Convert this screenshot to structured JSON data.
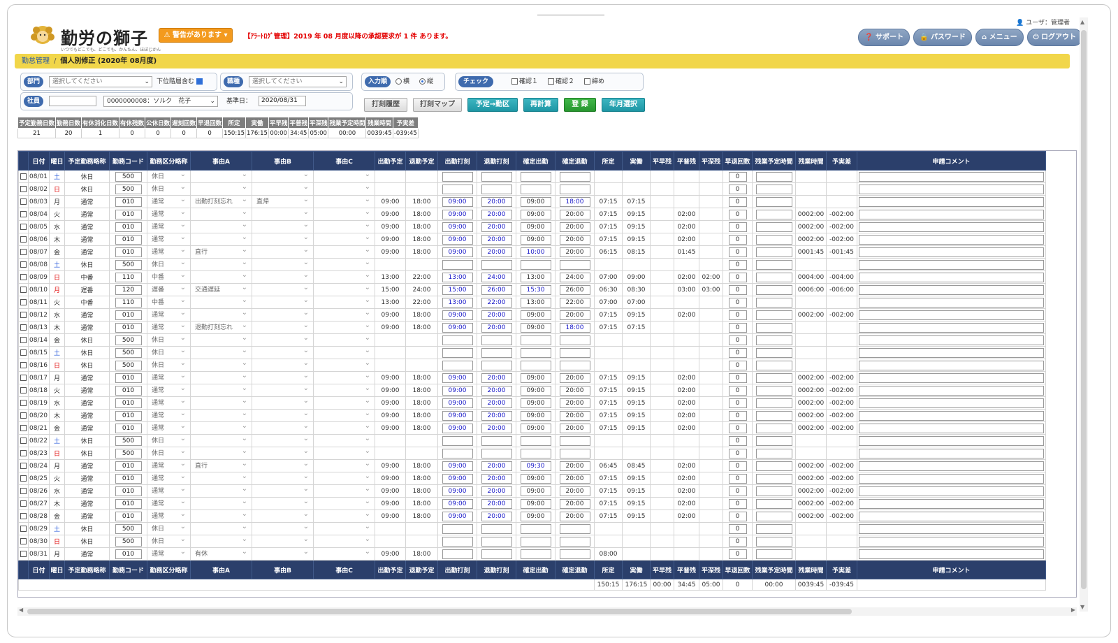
{
  "header": {
    "logo_text": "勤労の獅子",
    "logo_sub": "いつでもどこでも、どこでも、かんたん、ほぼじかん",
    "alert_button": "⚠ 警告があります ▾",
    "alert_message": "【ｱﾗｰﾄﾛｸﾞ管理】2019 年 08 月度以降の承認要求が 1 件 あります。",
    "user_label": "ユーザ：管理者",
    "nav": [
      "サポート",
      "パスワード",
      "メニュー",
      "ログアウト"
    ]
  },
  "breadcrumb": {
    "parent": "勤怠管理",
    "current": "個人別修正 (2020年 08月度)"
  },
  "filters": {
    "dept_label": "部門",
    "dept_value": "選択してください",
    "sub_dept": "下位階層含む",
    "job_label": "職種",
    "job_value": "選択してください",
    "input_label": "入力順",
    "radio_h": "横",
    "radio_v": "縦",
    "check_label": "チェック",
    "confirm1": "確認１",
    "confirm2": "確認２",
    "closing": "締め",
    "emp_label": "社員",
    "emp_code": "",
    "emp_value": "0000000008：ソルク　花子",
    "base_date_label": "基準日：",
    "base_date": "2020/08/31"
  },
  "actions": [
    "打刻履歴",
    "打刻マップ",
    "予定→勤区",
    "再計算",
    "登 録",
    "年月選択"
  ],
  "summary": {
    "headers": [
      "予定勤務日数",
      "勤務日数",
      "有休消化日数",
      "有休残数",
      "公休日数",
      "遅刻回数",
      "早退回数",
      "所定",
      "実働",
      "平早残",
      "平普残",
      "平深残",
      "残業予定時間",
      "残業時間",
      "予実差"
    ],
    "values": [
      "21",
      "20",
      "1",
      "0",
      "0",
      "0",
      "0",
      "150:15",
      "176:15",
      "00:00",
      "34:45",
      "05:00",
      "00:00",
      "0039:45",
      "-039:45"
    ]
  },
  "grid": {
    "headers": [
      "",
      "日付",
      "曜日",
      "予定勤務略称",
      "勤務コード",
      "勤務区分略称",
      "事由A",
      "事由B",
      "事由C",
      "出勤予定",
      "退勤予定",
      "出勤打刻",
      "退勤打刻",
      "確定出勤",
      "確定退勤",
      "所定",
      "実働",
      "平早残",
      "平普残",
      "平深残",
      "早退回数",
      "残業予定時間",
      "残業時間",
      "予実差",
      "申請コメント"
    ],
    "rows": [
      {
        "date": "08/01",
        "dow": "土",
        "plan": "休日",
        "code": "500",
        "kubun": "休日",
        "a": "",
        "b": "",
        "st_p": "",
        "en_p": "",
        "st_s": "",
        "en_s": "",
        "st_c": "",
        "en_c": "",
        "shotei": "",
        "jitsu": "",
        "hs": "",
        "hf": "",
        "hsh": "",
        "early": "0",
        "ot": "",
        "diff": "",
        "d": "sat"
      },
      {
        "date": "08/02",
        "dow": "日",
        "plan": "休日",
        "code": "500",
        "kubun": "休日",
        "a": "",
        "b": "",
        "st_p": "",
        "en_p": "",
        "st_s": "",
        "en_s": "",
        "st_c": "",
        "en_c": "",
        "shotei": "",
        "jitsu": "",
        "hs": "",
        "hf": "",
        "hsh": "",
        "early": "0",
        "ot": "",
        "diff": "",
        "d": "sun"
      },
      {
        "date": "08/03",
        "dow": "月",
        "plan": "通常",
        "code": "010",
        "kubun": "通常",
        "a": "出勤打刻忘れ",
        "b": "直帰",
        "st_p": "09:00",
        "en_p": "18:00",
        "st_s": "09:00",
        "en_s": "20:00",
        "st_c": "09:00",
        "en_c": "18:00",
        "shotei": "07:15",
        "jitsu": "07:15",
        "hs": "",
        "hf": "",
        "hsh": "",
        "early": "0",
        "ot": "",
        "diff": "",
        "d": ""
      },
      {
        "date": "08/04",
        "dow": "火",
        "plan": "通常",
        "code": "010",
        "kubun": "通常",
        "a": "",
        "b": "",
        "st_p": "09:00",
        "en_p": "18:00",
        "st_s": "09:00",
        "en_s": "20:00",
        "st_c": "09:00",
        "en_c": "20:00",
        "shotei": "07:15",
        "jitsu": "09:15",
        "hs": "",
        "hf": "02:00",
        "hsh": "",
        "early": "0",
        "ot": "0002:00",
        "diff": "-002:00",
        "d": ""
      },
      {
        "date": "08/05",
        "dow": "水",
        "plan": "通常",
        "code": "010",
        "kubun": "通常",
        "a": "",
        "b": "",
        "st_p": "09:00",
        "en_p": "18:00",
        "st_s": "09:00",
        "en_s": "20:00",
        "st_c": "09:00",
        "en_c": "20:00",
        "shotei": "07:15",
        "jitsu": "09:15",
        "hs": "",
        "hf": "02:00",
        "hsh": "",
        "early": "0",
        "ot": "0002:00",
        "diff": "-002:00",
        "d": ""
      },
      {
        "date": "08/06",
        "dow": "木",
        "plan": "通常",
        "code": "010",
        "kubun": "通常",
        "a": "",
        "b": "",
        "st_p": "09:00",
        "en_p": "18:00",
        "st_s": "09:00",
        "en_s": "20:00",
        "st_c": "09:00",
        "en_c": "20:00",
        "shotei": "07:15",
        "jitsu": "09:15",
        "hs": "",
        "hf": "02:00",
        "hsh": "",
        "early": "0",
        "ot": "0002:00",
        "diff": "-002:00",
        "d": ""
      },
      {
        "date": "08/07",
        "dow": "金",
        "plan": "通常",
        "code": "010",
        "kubun": "通常",
        "a": "直行",
        "b": "",
        "st_p": "09:00",
        "en_p": "18:00",
        "st_s": "09:00",
        "en_s": "20:00",
        "st_c": "10:00",
        "en_c": "20:00",
        "shotei": "06:15",
        "jitsu": "08:15",
        "hs": "",
        "hf": "01:45",
        "hsh": "",
        "early": "0",
        "ot": "0001:45",
        "diff": "-001:45",
        "d": ""
      },
      {
        "date": "08/08",
        "dow": "土",
        "plan": "休日",
        "code": "500",
        "kubun": "休日",
        "a": "",
        "b": "",
        "st_p": "",
        "en_p": "",
        "st_s": "",
        "en_s": "",
        "st_c": "",
        "en_c": "",
        "shotei": "",
        "jitsu": "",
        "hs": "",
        "hf": "",
        "hsh": "",
        "early": "0",
        "ot": "",
        "diff": "",
        "d": "sat"
      },
      {
        "date": "08/09",
        "dow": "日",
        "plan": "中番",
        "code": "110",
        "kubun": "中番",
        "a": "",
        "b": "",
        "st_p": "13:00",
        "en_p": "22:00",
        "st_s": "13:00",
        "en_s": "24:00",
        "st_c": "13:00",
        "en_c": "24:00",
        "shotei": "07:00",
        "jitsu": "09:00",
        "hs": "",
        "hf": "02:00",
        "hsh": "02:00",
        "early": "0",
        "ot": "0004:00",
        "diff": "-004:00",
        "d": "sun"
      },
      {
        "date": "08/10",
        "dow": "月",
        "plan": "遅番",
        "code": "120",
        "kubun": "遅番",
        "a": "交通遅延",
        "b": "",
        "st_p": "15:00",
        "en_p": "24:00",
        "st_s": "15:00",
        "en_s": "26:00",
        "st_c": "15:30",
        "en_c": "26:00",
        "shotei": "06:30",
        "jitsu": "08:30",
        "hs": "",
        "hf": "03:00",
        "hsh": "03:00",
        "early": "0",
        "ot": "0006:00",
        "diff": "-006:00",
        "d": "mon"
      },
      {
        "date": "08/11",
        "dow": "火",
        "plan": "中番",
        "code": "110",
        "kubun": "中番",
        "a": "",
        "b": "",
        "st_p": "13:00",
        "en_p": "22:00",
        "st_s": "13:00",
        "en_s": "22:00",
        "st_c": "13:00",
        "en_c": "22:00",
        "shotei": "07:00",
        "jitsu": "07:00",
        "hs": "",
        "hf": "",
        "hsh": "",
        "early": "0",
        "ot": "",
        "diff": "",
        "d": ""
      },
      {
        "date": "08/12",
        "dow": "水",
        "plan": "通常",
        "code": "010",
        "kubun": "通常",
        "a": "",
        "b": "",
        "st_p": "09:00",
        "en_p": "18:00",
        "st_s": "09:00",
        "en_s": "20:00",
        "st_c": "09:00",
        "en_c": "20:00",
        "shotei": "07:15",
        "jitsu": "09:15",
        "hs": "",
        "hf": "02:00",
        "hsh": "",
        "early": "0",
        "ot": "0002:00",
        "diff": "-002:00",
        "d": ""
      },
      {
        "date": "08/13",
        "dow": "木",
        "plan": "通常",
        "code": "010",
        "kubun": "通常",
        "a": "退勤打刻忘れ",
        "b": "",
        "st_p": "09:00",
        "en_p": "18:00",
        "st_s": "09:00",
        "en_s": "20:00",
        "st_c": "09:00",
        "en_c": "18:00",
        "shotei": "07:15",
        "jitsu": "07:15",
        "hs": "",
        "hf": "",
        "hsh": "",
        "early": "0",
        "ot": "",
        "diff": "",
        "d": ""
      },
      {
        "date": "08/14",
        "dow": "金",
        "plan": "休日",
        "code": "500",
        "kubun": "休日",
        "a": "",
        "b": "",
        "st_p": "",
        "en_p": "",
        "st_s": "",
        "en_s": "",
        "st_c": "",
        "en_c": "",
        "shotei": "",
        "jitsu": "",
        "hs": "",
        "hf": "",
        "hsh": "",
        "early": "0",
        "ot": "",
        "diff": "",
        "d": ""
      },
      {
        "date": "08/15",
        "dow": "土",
        "plan": "休日",
        "code": "500",
        "kubun": "休日",
        "a": "",
        "b": "",
        "st_p": "",
        "en_p": "",
        "st_s": "",
        "en_s": "",
        "st_c": "",
        "en_c": "",
        "shotei": "",
        "jitsu": "",
        "hs": "",
        "hf": "",
        "hsh": "",
        "early": "0",
        "ot": "",
        "diff": "",
        "d": "sat"
      },
      {
        "date": "08/16",
        "dow": "日",
        "plan": "休日",
        "code": "500",
        "kubun": "休日",
        "a": "",
        "b": "",
        "st_p": "",
        "en_p": "",
        "st_s": "",
        "en_s": "",
        "st_c": "",
        "en_c": "",
        "shotei": "",
        "jitsu": "",
        "hs": "",
        "hf": "",
        "hsh": "",
        "early": "0",
        "ot": "",
        "diff": "",
        "d": "sun"
      },
      {
        "date": "08/17",
        "dow": "月",
        "plan": "通常",
        "code": "010",
        "kubun": "通常",
        "a": "",
        "b": "",
        "st_p": "09:00",
        "en_p": "18:00",
        "st_s": "09:00",
        "en_s": "20:00",
        "st_c": "09:00",
        "en_c": "20:00",
        "shotei": "07:15",
        "jitsu": "09:15",
        "hs": "",
        "hf": "02:00",
        "hsh": "",
        "early": "0",
        "ot": "0002:00",
        "diff": "-002:00",
        "d": ""
      },
      {
        "date": "08/18",
        "dow": "火",
        "plan": "通常",
        "code": "010",
        "kubun": "通常",
        "a": "",
        "b": "",
        "st_p": "09:00",
        "en_p": "18:00",
        "st_s": "09:00",
        "en_s": "20:00",
        "st_c": "09:00",
        "en_c": "20:00",
        "shotei": "07:15",
        "jitsu": "09:15",
        "hs": "",
        "hf": "02:00",
        "hsh": "",
        "early": "0",
        "ot": "0002:00",
        "diff": "-002:00",
        "d": ""
      },
      {
        "date": "08/19",
        "dow": "水",
        "plan": "通常",
        "code": "010",
        "kubun": "通常",
        "a": "",
        "b": "",
        "st_p": "09:00",
        "en_p": "18:00",
        "st_s": "09:00",
        "en_s": "20:00",
        "st_c": "09:00",
        "en_c": "20:00",
        "shotei": "07:15",
        "jitsu": "09:15",
        "hs": "",
        "hf": "02:00",
        "hsh": "",
        "early": "0",
        "ot": "0002:00",
        "diff": "-002:00",
        "d": ""
      },
      {
        "date": "08/20",
        "dow": "木",
        "plan": "通常",
        "code": "010",
        "kubun": "通常",
        "a": "",
        "b": "",
        "st_p": "09:00",
        "en_p": "18:00",
        "st_s": "09:00",
        "en_s": "20:00",
        "st_c": "09:00",
        "en_c": "20:00",
        "shotei": "07:15",
        "jitsu": "09:15",
        "hs": "",
        "hf": "02:00",
        "hsh": "",
        "early": "0",
        "ot": "0002:00",
        "diff": "-002:00",
        "d": ""
      },
      {
        "date": "08/21",
        "dow": "金",
        "plan": "通常",
        "code": "010",
        "kubun": "通常",
        "a": "",
        "b": "",
        "st_p": "09:00",
        "en_p": "18:00",
        "st_s": "09:00",
        "en_s": "20:00",
        "st_c": "09:00",
        "en_c": "20:00",
        "shotei": "07:15",
        "jitsu": "09:15",
        "hs": "",
        "hf": "02:00",
        "hsh": "",
        "early": "0",
        "ot": "0002:00",
        "diff": "-002:00",
        "d": ""
      },
      {
        "date": "08/22",
        "dow": "土",
        "plan": "休日",
        "code": "500",
        "kubun": "休日",
        "a": "",
        "b": "",
        "st_p": "",
        "en_p": "",
        "st_s": "",
        "en_s": "",
        "st_c": "",
        "en_c": "",
        "shotei": "",
        "jitsu": "",
        "hs": "",
        "hf": "",
        "hsh": "",
        "early": "0",
        "ot": "",
        "diff": "",
        "d": "sat"
      },
      {
        "date": "08/23",
        "dow": "日",
        "plan": "休日",
        "code": "500",
        "kubun": "休日",
        "a": "",
        "b": "",
        "st_p": "",
        "en_p": "",
        "st_s": "",
        "en_s": "",
        "st_c": "",
        "en_c": "",
        "shotei": "",
        "jitsu": "",
        "hs": "",
        "hf": "",
        "hsh": "",
        "early": "0",
        "ot": "",
        "diff": "",
        "d": "sun"
      },
      {
        "date": "08/24",
        "dow": "月",
        "plan": "通常",
        "code": "010",
        "kubun": "通常",
        "a": "直行",
        "b": "",
        "st_p": "09:00",
        "en_p": "18:00",
        "st_s": "09:00",
        "en_s": "20:00",
        "st_c": "09:30",
        "en_c": "20:00",
        "shotei": "06:45",
        "jitsu": "08:45",
        "hs": "",
        "hf": "02:00",
        "hsh": "",
        "early": "0",
        "ot": "0002:00",
        "diff": "-002:00",
        "d": ""
      },
      {
        "date": "08/25",
        "dow": "火",
        "plan": "通常",
        "code": "010",
        "kubun": "通常",
        "a": "",
        "b": "",
        "st_p": "09:00",
        "en_p": "18:00",
        "st_s": "09:00",
        "en_s": "20:00",
        "st_c": "09:00",
        "en_c": "20:00",
        "shotei": "07:15",
        "jitsu": "09:15",
        "hs": "",
        "hf": "02:00",
        "hsh": "",
        "early": "0",
        "ot": "0002:00",
        "diff": "-002:00",
        "d": ""
      },
      {
        "date": "08/26",
        "dow": "水",
        "plan": "通常",
        "code": "010",
        "kubun": "通常",
        "a": "",
        "b": "",
        "st_p": "09:00",
        "en_p": "18:00",
        "st_s": "09:00",
        "en_s": "20:00",
        "st_c": "09:00",
        "en_c": "20:00",
        "shotei": "07:15",
        "jitsu": "09:15",
        "hs": "",
        "hf": "02:00",
        "hsh": "",
        "early": "0",
        "ot": "0002:00",
        "diff": "-002:00",
        "d": ""
      },
      {
        "date": "08/27",
        "dow": "木",
        "plan": "通常",
        "code": "010",
        "kubun": "通常",
        "a": "",
        "b": "",
        "st_p": "09:00",
        "en_p": "18:00",
        "st_s": "09:00",
        "en_s": "20:00",
        "st_c": "09:00",
        "en_c": "20:00",
        "shotei": "07:15",
        "jitsu": "09:15",
        "hs": "",
        "hf": "02:00",
        "hsh": "",
        "early": "0",
        "ot": "0002:00",
        "diff": "-002:00",
        "d": ""
      },
      {
        "date": "08/28",
        "dow": "金",
        "plan": "通常",
        "code": "010",
        "kubun": "通常",
        "a": "",
        "b": "",
        "st_p": "09:00",
        "en_p": "18:00",
        "st_s": "09:00",
        "en_s": "20:00",
        "st_c": "09:00",
        "en_c": "20:00",
        "shotei": "07:15",
        "jitsu": "09:15",
        "hs": "",
        "hf": "02:00",
        "hsh": "",
        "early": "0",
        "ot": "0002:00",
        "diff": "-002:00",
        "d": ""
      },
      {
        "date": "08/29",
        "dow": "土",
        "plan": "休日",
        "code": "500",
        "kubun": "休日",
        "a": "",
        "b": "",
        "st_p": "",
        "en_p": "",
        "st_s": "",
        "en_s": "",
        "st_c": "",
        "en_c": "",
        "shotei": "",
        "jitsu": "",
        "hs": "",
        "hf": "",
        "hsh": "",
        "early": "0",
        "ot": "",
        "diff": "",
        "d": "sat"
      },
      {
        "date": "08/30",
        "dow": "日",
        "plan": "休日",
        "code": "500",
        "kubun": "休日",
        "a": "",
        "b": "",
        "st_p": "",
        "en_p": "",
        "st_s": "",
        "en_s": "",
        "st_c": "",
        "en_c": "",
        "shotei": "",
        "jitsu": "",
        "hs": "",
        "hf": "",
        "hsh": "",
        "early": "0",
        "ot": "",
        "diff": "",
        "d": "sun"
      },
      {
        "date": "08/31",
        "dow": "月",
        "plan": "通常",
        "code": "010",
        "kubun": "通常",
        "a": "有休",
        "b": "",
        "st_p": "09:00",
        "en_p": "18:00",
        "st_s": "",
        "en_s": "",
        "st_c": "",
        "en_c": "",
        "shotei": "08:00",
        "jitsu": "",
        "hs": "",
        "hf": "",
        "hsh": "",
        "early": "0",
        "ot": "",
        "diff": "",
        "d": ""
      }
    ],
    "footer_totals": {
      "shotei": "150:15",
      "jitsu": "176:15",
      "hs": "00:00",
      "hf": "34:45",
      "hsh": "05:00",
      "early": "0",
      "ot_plan": "00:00",
      "ot": "0039:45",
      "diff": "-039:45"
    }
  }
}
